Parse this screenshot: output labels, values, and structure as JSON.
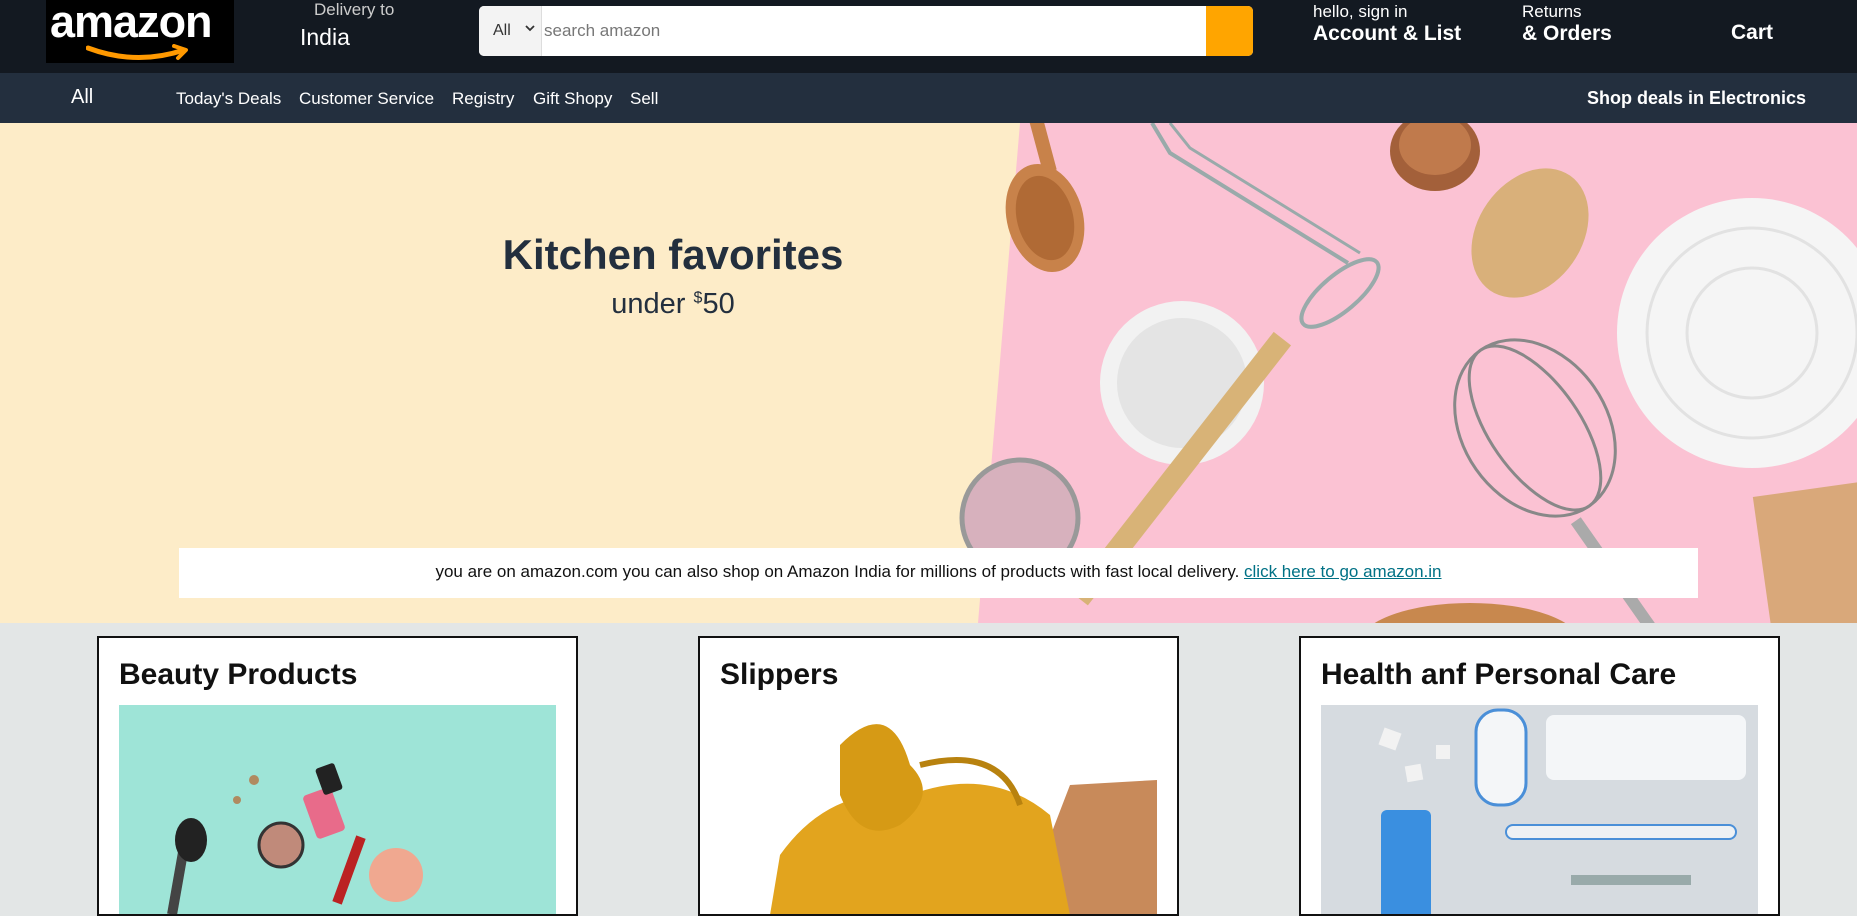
{
  "header": {
    "logo_text": "amazon",
    "delivery_line1": "Delivery to",
    "delivery_line2": "India",
    "search": {
      "category": "All",
      "placeholder": "search amazon"
    },
    "account_line1": "hello, sign in",
    "account_line2": "Account & List",
    "orders_line1": "Returns",
    "orders_line2": "& Orders",
    "cart": "Cart"
  },
  "subnav": {
    "all": "All",
    "items": [
      "Today's Deals",
      "Customer Service",
      "Registry",
      "Gift Shopy",
      "Sell"
    ],
    "right": "Shop deals in Electronics"
  },
  "hero": {
    "title": "Kitchen favorites",
    "subtitle_prefix": "under ",
    "currency": "$",
    "price": "50"
  },
  "notice": {
    "text": "you are on amazon.com you can also shop on Amazon India for millions of products with fast local delivery. ",
    "link": "click here to go amazon.in"
  },
  "cards": [
    {
      "title": "Beauty Products"
    },
    {
      "title": "Slippers"
    },
    {
      "title": "Health anf Personal Care"
    }
  ],
  "colors": {
    "header_bg": "#131921",
    "subnav_bg": "#232f3e",
    "search_button": "#ffa500",
    "hero_bg": "#fdecc8",
    "hero_pink": "#fbc2d3",
    "link": "#007185"
  },
  "icons": [
    "chevron-down-icon",
    "amazon-smile-icon"
  ]
}
